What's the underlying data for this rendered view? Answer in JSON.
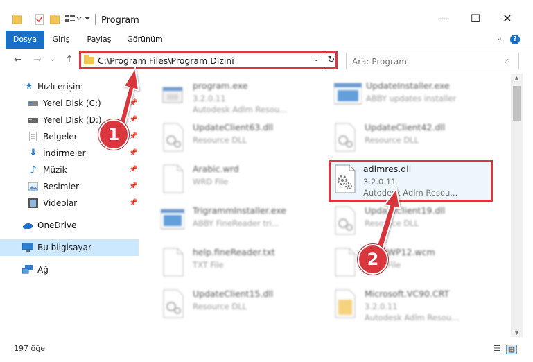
{
  "window": {
    "title": "Program",
    "minimize_glyph": "—",
    "maximize_glyph": "☐",
    "close_glyph": "✕"
  },
  "ribbon": {
    "tabs": [
      {
        "label": "Dosya",
        "active": true
      },
      {
        "label": "Giriş",
        "active": false
      },
      {
        "label": "Paylaş",
        "active": false
      },
      {
        "label": "Görünüm",
        "active": false
      }
    ],
    "help_glyph": "?",
    "expand_glyph": "⌄"
  },
  "nav": {
    "back_glyph": "←",
    "forward_glyph": "→",
    "recent_glyph": "⌄",
    "up_glyph": "↑",
    "address_path": "C:\\Program Files\\Program Dizini",
    "address_dropdown_glyph": "⌄",
    "refresh_glyph": "↻",
    "search_placeholder": "Ara: Program",
    "search_glyph": "⌕"
  },
  "sidebar": {
    "items": [
      {
        "label": "Hızlı erişim",
        "icon": "star-icon"
      },
      {
        "label": "Yerel Disk (C:)",
        "icon": "drive-icon"
      },
      {
        "label": "Yerel Disk (D:)",
        "icon": "drive-icon"
      },
      {
        "label": "Belgeler",
        "icon": "documents-icon"
      },
      {
        "label": "İndirmeler",
        "icon": "download-icon"
      },
      {
        "label": "Müzik",
        "icon": "music-icon"
      },
      {
        "label": "Resimler",
        "icon": "pictures-icon"
      },
      {
        "label": "Videolar",
        "icon": "videos-icon"
      },
      {
        "label": "OneDrive",
        "icon": "cloud-icon"
      },
      {
        "label": "Bu bilgisayar",
        "icon": "computer-icon",
        "selected": true
      },
      {
        "label": "Ağ",
        "icon": "network-icon"
      }
    ],
    "pin_glyph": "📌"
  },
  "files": [
    {
      "name": "program.exe",
      "line2": "3.2.0.11",
      "line3": "Autodesk Adlm Resou...",
      "type": "exe"
    },
    {
      "name": "UpdateInstaller.exe",
      "line2": "ABBY updates installer",
      "line3": "",
      "type": "exe"
    },
    {
      "name": "UpdateClient63.dll",
      "line2": "Resource DLL",
      "line3": "",
      "type": "dll"
    },
    {
      "name": "UpdateClient42.dll",
      "line2": "Resource DLL",
      "line3": "",
      "type": "dll"
    },
    {
      "name": "Arabic.wrd",
      "line2": "WRD File",
      "line3": "",
      "type": "file"
    },
    {
      "name": "adlmres.dll",
      "line2": "3.2.0.11",
      "line3": "Autodesk Adlm Resou...",
      "type": "dll"
    },
    {
      "name": "TrigrammInstaller.exe",
      "line2": "ABBY FineReader tri...",
      "line3": "",
      "type": "exe"
    },
    {
      "name": "UpdateClient19.dll",
      "line2": "Resource DLL",
      "line3": "",
      "type": "dll"
    },
    {
      "name": "help.fineReader.txt",
      "line2": "TXT File",
      "line3": "",
      "type": "file"
    },
    {
      "name": "ABBYWP12.wcm",
      "line2": "WCM File",
      "line3": "",
      "type": "file"
    },
    {
      "name": "UpdateClient15.dll",
      "line2": "Resource DLL",
      "line3": "",
      "type": "dll"
    },
    {
      "name": "Microsoft.VC90.CRT",
      "line2": "3.2.0.11",
      "line3": "Autodesk Adlm Resou...",
      "type": "folder"
    }
  ],
  "status": {
    "item_count": "197 öğe"
  },
  "callouts": [
    "1",
    "2"
  ],
  "colors": {
    "accent": "#1a70c6",
    "highlight_red": "#d9363e",
    "selection": "#cce8ff"
  }
}
